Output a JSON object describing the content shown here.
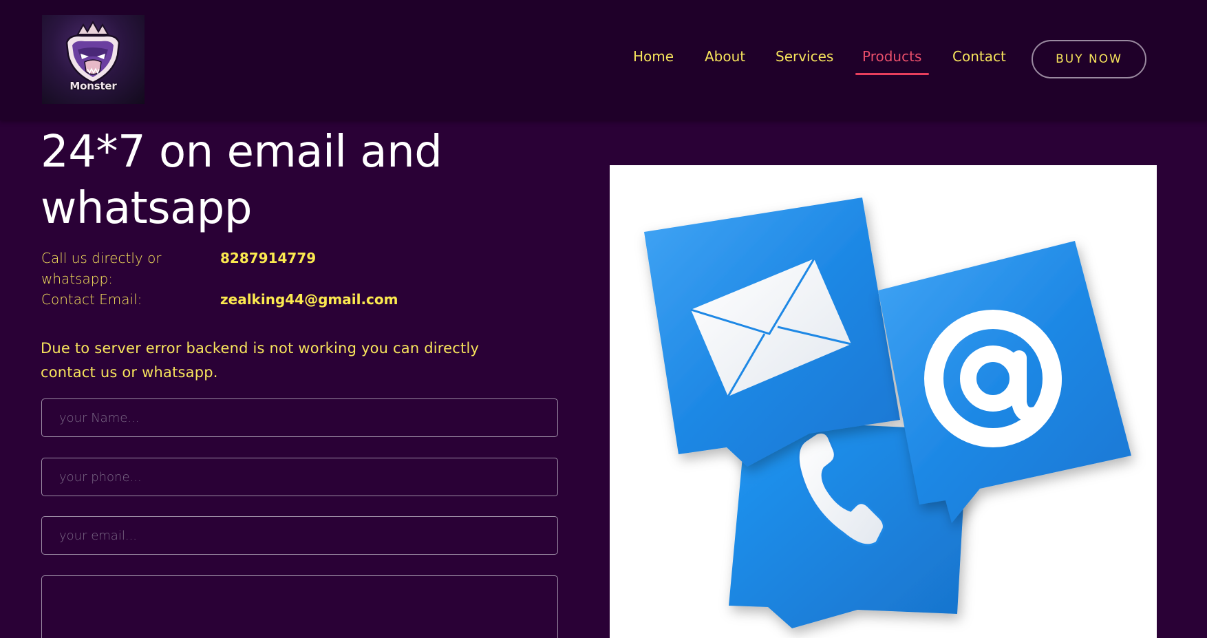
{
  "brand": {
    "logo_text": "Monster"
  },
  "nav": {
    "items": [
      {
        "label": "Home"
      },
      {
        "label": "About"
      },
      {
        "label": "Services"
      },
      {
        "label": "Products"
      },
      {
        "label": "Contact"
      }
    ],
    "active": "Products",
    "cta_label": "BUY NOW"
  },
  "main": {
    "heading": "24*7 on email and whatsapp",
    "contact": {
      "phone_label": "Call us directly or whatsapp:",
      "phone_value": "8287914779",
      "email_label": "Contact Email:",
      "email_value": "zealking44@gmail.com"
    },
    "notice": "Due to server error backend is not working you can directly contact us or whatsapp.",
    "form": {
      "name_placeholder": "your Name...",
      "phone_placeholder": "your phone...",
      "email_placeholder": "your email...",
      "message_placeholder": ""
    }
  },
  "illustration": {
    "icons": [
      "envelope-icon",
      "at-sign-icon",
      "phone-icon"
    ]
  },
  "colors": {
    "background": "#2a0136",
    "header_background": "#1f0029",
    "accent_yellow": "#f7e45c",
    "active_link": "#ea4f6b",
    "icon_blue": "#1e88e5"
  }
}
